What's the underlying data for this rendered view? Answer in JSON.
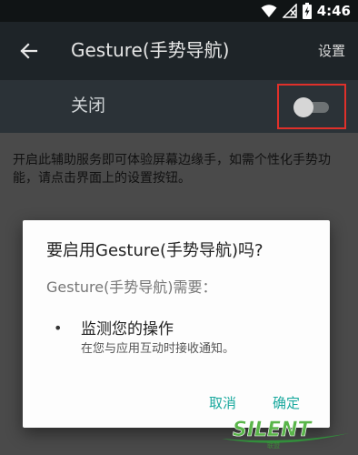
{
  "status_bar": {
    "time": "4:46"
  },
  "app_bar": {
    "title": "Gesture(手势导航)",
    "settings_label": "设置"
  },
  "switch_row": {
    "label": "关闭",
    "enabled": false
  },
  "description": "开启此辅助服务即可体验屏幕边缘手，如需个性化手势功能，请点击界面上的设置按钮。",
  "dialog": {
    "title": "要启用Gesture(手势导航)吗?",
    "subtitle": "Gesture(手势导航)需要：",
    "bullet": "•",
    "permission_title": "监测您的操作",
    "permission_desc": "在您与应用互动时接收通知。",
    "cancel_label": "取消",
    "confirm_label": "确定"
  },
  "watermark": {
    "text": "SILENT",
    "small_text": "联盟"
  },
  "colors": {
    "accent": "#1aa99e",
    "highlight": "#e0302a",
    "app_bar": "#1e2428",
    "switch_bar": "#2b3237"
  }
}
